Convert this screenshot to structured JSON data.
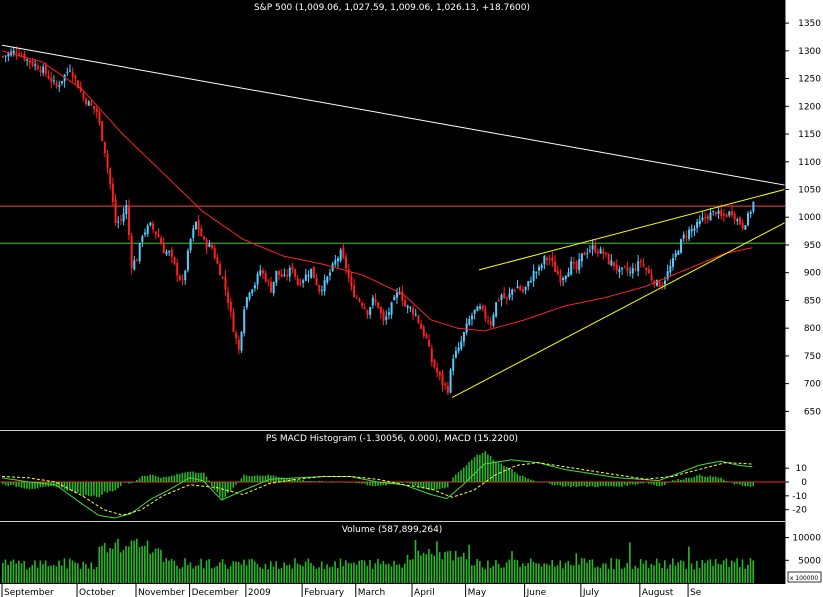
{
  "chart_data": [
    {
      "type": "candlestick",
      "title": "S&P 500 (1,009.06, 1,027.59, 1,009.06, 1,026.13, +18.7600)",
      "xlabels": [
        "September",
        "October",
        "November",
        "December",
        "2009",
        "February",
        "March",
        "April",
        "May",
        "June",
        "July",
        "August",
        "Se"
      ],
      "yticks": [
        1350,
        1300,
        1250,
        1200,
        1150,
        1100,
        1050,
        1000,
        950,
        900,
        850,
        800,
        750,
        700,
        650
      ],
      "ylim": [
        620,
        1370
      ],
      "close_anchors": [
        [
          0,
          1290
        ],
        [
          5,
          1300
        ],
        [
          10,
          1280
        ],
        [
          15,
          1265
        ],
        [
          20,
          1235
        ],
        [
          25,
          1270
        ],
        [
          30,
          1215
        ],
        [
          35,
          1190
        ],
        [
          38,
          1120
        ],
        [
          40,
          1060
        ],
        [
          42,
          990
        ],
        [
          44,
          995
        ],
        [
          46,
          1020
        ],
        [
          48,
          915
        ],
        [
          50,
          925
        ],
        [
          52,
          970
        ],
        [
          55,
          985
        ],
        [
          58,
          965
        ],
        [
          60,
          940
        ],
        [
          62,
          935
        ],
        [
          65,
          900
        ],
        [
          67,
          880
        ],
        [
          70,
          960
        ],
        [
          72,
          990
        ],
        [
          75,
          955
        ],
        [
          78,
          945
        ],
        [
          80,
          915
        ],
        [
          82,
          890
        ],
        [
          84,
          850
        ],
        [
          86,
          800
        ],
        [
          88,
          760
        ],
        [
          90,
          840
        ],
        [
          92,
          870
        ],
        [
          94,
          880
        ],
        [
          96,
          905
        ],
        [
          98,
          890
        ],
        [
          100,
          870
        ],
        [
          102,
          900
        ],
        [
          105,
          890
        ],
        [
          108,
          910
        ],
        [
          110,
          880
        ],
        [
          112,
          890
        ],
        [
          115,
          905
        ],
        [
          118,
          870
        ],
        [
          120,
          880
        ],
        [
          122,
          900
        ],
        [
          124,
          920
        ],
        [
          126,
          935
        ],
        [
          128,
          910
        ],
        [
          130,
          870
        ],
        [
          132,
          855
        ],
        [
          134,
          845
        ],
        [
          136,
          830
        ],
        [
          138,
          850
        ],
        [
          140,
          840
        ],
        [
          142,
          810
        ],
        [
          144,
          830
        ],
        [
          146,
          850
        ],
        [
          148,
          870
        ],
        [
          150,
          840
        ],
        [
          152,
          835
        ],
        [
          154,
          825
        ],
        [
          156,
          800
        ],
        [
          158,
          780
        ],
        [
          160,
          740
        ],
        [
          162,
          720
        ],
        [
          164,
          700
        ],
        [
          166,
          690
        ],
        [
          168,
          750
        ],
        [
          170,
          760
        ],
        [
          172,
          790
        ],
        [
          174,
          815
        ],
        [
          176,
          830
        ],
        [
          178,
          835
        ],
        [
          180,
          820
        ],
        [
          182,
          810
        ],
        [
          184,
          845
        ],
        [
          186,
          860
        ],
        [
          188,
          850
        ],
        [
          190,
          870
        ],
        [
          192,
          875
        ],
        [
          194,
          865
        ],
        [
          196,
          880
        ],
        [
          198,
          900
        ],
        [
          200,
          905
        ],
        [
          202,
          925
        ],
        [
          204,
          925
        ],
        [
          206,
          905
        ],
        [
          208,
          890
        ],
        [
          210,
          900
        ],
        [
          212,
          915
        ],
        [
          214,
          905
        ],
        [
          216,
          930
        ],
        [
          218,
          940
        ],
        [
          220,
          945
        ],
        [
          222,
          940
        ],
        [
          224,
          935
        ],
        [
          226,
          920
        ],
        [
          228,
          915
        ],
        [
          230,
          900
        ],
        [
          232,
          905
        ],
        [
          234,
          900
        ],
        [
          236,
          910
        ],
        [
          238,
          920
        ],
        [
          240,
          905
        ],
        [
          242,
          890
        ],
        [
          244,
          880
        ],
        [
          246,
          880
        ],
        [
          248,
          900
        ],
        [
          250,
          920
        ],
        [
          252,
          945
        ],
        [
          254,
          965
        ],
        [
          256,
          975
        ],
        [
          258,
          980
        ],
        [
          260,
          990
        ],
        [
          262,
          1000
        ],
        [
          264,
          1005
        ],
        [
          266,
          1010
        ],
        [
          268,
          1000
        ],
        [
          270,
          1005
        ],
        [
          272,
          1010
        ],
        [
          274,
          995
        ],
        [
          276,
          985
        ],
        [
          278,
          1000
        ],
        [
          280,
          1026
        ]
      ],
      "ma_anchors": [
        [
          0,
          1300
        ],
        [
          15,
          1280
        ],
        [
          30,
          1230
        ],
        [
          45,
          1150
        ],
        [
          60,
          1080
        ],
        [
          75,
          1010
        ],
        [
          90,
          960
        ],
        [
          105,
          930
        ],
        [
          120,
          915
        ],
        [
          135,
          895
        ],
        [
          150,
          860
        ],
        [
          160,
          815
        ],
        [
          170,
          800
        ],
        [
          180,
          795
        ],
        [
          195,
          815
        ],
        [
          210,
          840
        ],
        [
          225,
          855
        ],
        [
          240,
          875
        ],
        [
          255,
          905
        ],
        [
          270,
          935
        ],
        [
          280,
          945
        ]
      ],
      "trend_lines": [
        {
          "from": [
            0,
            1310
          ],
          "to": [
            292,
            1058
          ],
          "color": "#ffffff"
        },
        {
          "from": [
            168,
            675
          ],
          "to": [
            292,
            990
          ],
          "color": "#ffff00"
        },
        {
          "from": [
            178,
            905
          ],
          "to": [
            292,
            1050
          ],
          "color": "#ffff00"
        }
      ],
      "hlines": [
        {
          "value": 1020,
          "color": "#ff4040"
        },
        {
          "value": 953,
          "color": "#2ecc2e"
        }
      ],
      "colors": {
        "up": "#55ccff",
        "down": "#ff2020",
        "ma": "#ff2020"
      }
    },
    {
      "type": "macd",
      "title": "PS MACD Histogram (-1.30056, 0.000), MACD (15.2200)",
      "yticks": [
        10,
        0,
        -10,
        -20
      ],
      "ylim": [
        -26,
        26
      ],
      "macd_anchors": [
        [
          0,
          3
        ],
        [
          10,
          0
        ],
        [
          20,
          -2
        ],
        [
          30,
          -16
        ],
        [
          36,
          -24
        ],
        [
          42,
          -26
        ],
        [
          48,
          -23
        ],
        [
          55,
          -13
        ],
        [
          62,
          -6
        ],
        [
          70,
          3
        ],
        [
          75,
          1
        ],
        [
          82,
          -13
        ],
        [
          90,
          -6
        ],
        [
          100,
          2
        ],
        [
          110,
          3
        ],
        [
          120,
          4
        ],
        [
          130,
          4
        ],
        [
          140,
          0
        ],
        [
          150,
          -2
        ],
        [
          160,
          -9
        ],
        [
          166,
          -12
        ],
        [
          172,
          -2
        ],
        [
          180,
          13
        ],
        [
          190,
          16
        ],
        [
          200,
          14
        ],
        [
          210,
          9
        ],
        [
          220,
          6
        ],
        [
          230,
          3
        ],
        [
          238,
          2
        ],
        [
          245,
          1
        ],
        [
          252,
          6
        ],
        [
          260,
          12
        ],
        [
          268,
          15
        ],
        [
          275,
          12
        ],
        [
          280,
          11
        ]
      ],
      "signal_anchors": [
        [
          0,
          4
        ],
        [
          10,
          3
        ],
        [
          20,
          0
        ],
        [
          30,
          -10
        ],
        [
          38,
          -20
        ],
        [
          45,
          -24
        ],
        [
          52,
          -20
        ],
        [
          60,
          -10
        ],
        [
          70,
          -2
        ],
        [
          80,
          -4
        ],
        [
          90,
          -9
        ],
        [
          100,
          -1
        ],
        [
          110,
          2
        ],
        [
          120,
          4
        ],
        [
          130,
          4
        ],
        [
          140,
          2
        ],
        [
          150,
          -2
        ],
        [
          160,
          -5
        ],
        [
          168,
          -11
        ],
        [
          176,
          -6
        ],
        [
          184,
          5
        ],
        [
          192,
          12
        ],
        [
          200,
          14
        ],
        [
          210,
          11
        ],
        [
          220,
          8
        ],
        [
          230,
          5
        ],
        [
          240,
          2
        ],
        [
          250,
          4
        ],
        [
          260,
          9
        ],
        [
          270,
          14
        ],
        [
          280,
          13
        ]
      ]
    },
    {
      "type": "bar",
      "title": "Volume (587,899,264)",
      "yticks": [
        10000,
        5000
      ],
      "ylim": [
        0,
        13000
      ],
      "axis_box_label": "x 100000"
    }
  ]
}
